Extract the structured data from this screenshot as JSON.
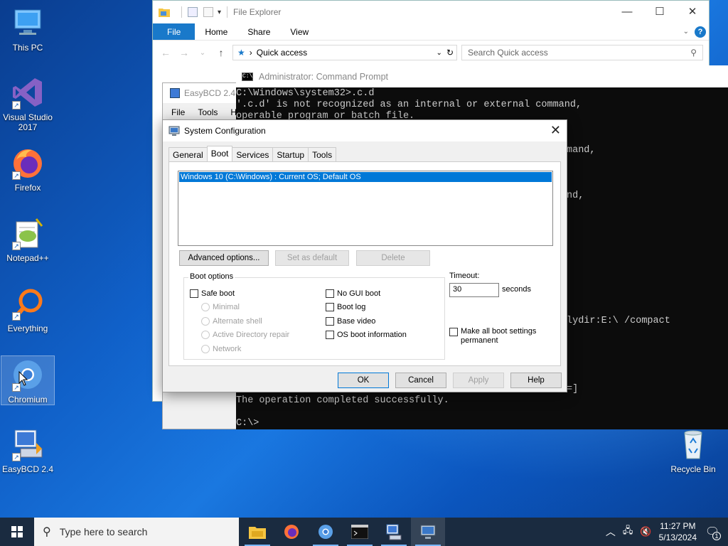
{
  "desktop": {
    "icons": [
      {
        "label": "This PC"
      },
      {
        "label": "Visual Studio 2017"
      },
      {
        "label": "Firefox"
      },
      {
        "label": "Notepad++"
      },
      {
        "label": "Everything"
      },
      {
        "label": "Chromium"
      },
      {
        "label": "EasyBCD 2.4"
      },
      {
        "label": "Recycle Bin"
      }
    ]
  },
  "explorer": {
    "title": "File Explorer",
    "tabs": [
      "File",
      "Home",
      "Share",
      "View"
    ],
    "address": "Quick access",
    "search_placeholder": "Search Quick access"
  },
  "easybcd": {
    "title": "EasyBCD 2.4",
    "menu": [
      "File",
      "Tools",
      "H"
    ]
  },
  "cmd": {
    "title": "Administrator: Command Prompt",
    "lines": [
      "C:\\Windows\\system32>.c.d",
      "'.c.d' is not recognized as an internal or external command,",
      "operable program or batch file.",
      "mand,",
      "nd,",
      "lydir:E:\\ /compact",
      "=]",
      "The operation completed successfully.",
      "C:\\>"
    ]
  },
  "msconfig": {
    "title": "System Configuration",
    "tabs": [
      "General",
      "Boot",
      "Services",
      "Startup",
      "Tools"
    ],
    "os_entry": "Windows 10 (C:\\Windows) : Current OS; Default OS",
    "buttons": {
      "advanced": "Advanced options...",
      "set_default": "Set as default",
      "delete": "Delete",
      "ok": "OK",
      "cancel": "Cancel",
      "apply": "Apply",
      "help": "Help"
    },
    "boot_options_label": "Boot options",
    "safe_boot": "Safe boot",
    "radios": [
      "Minimal",
      "Alternate shell",
      "Active Directory repair",
      "Network"
    ],
    "checks": [
      "No GUI boot",
      "Boot log",
      "Base video",
      "OS boot information"
    ],
    "timeout_label": "Timeout:",
    "timeout_value": "30",
    "seconds_label": "seconds",
    "make_permanent": "Make all boot settings permanent"
  },
  "taskbar": {
    "search_placeholder": "Type here to search",
    "time": "11:27 PM",
    "date": "5/13/2024",
    "notification_count": "1"
  }
}
